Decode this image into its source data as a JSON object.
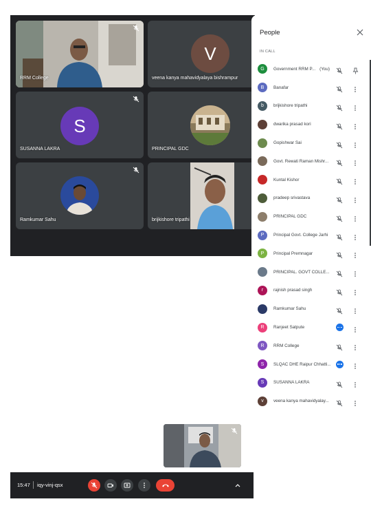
{
  "tiles": {
    "rrm": {
      "name": "RRM College"
    },
    "veena": {
      "name": "veena kanya mahavidyalaya bishrampur",
      "initial": "V"
    },
    "susanna": {
      "name": "SUSANNA LAKRA",
      "initial": "S"
    },
    "principal_gdc": {
      "name": "PRINCIPAL GDC"
    },
    "ramkumar": {
      "name": "Ramkumar Sahu"
    },
    "brijkishore": {
      "name": "brijkishore tripathi"
    }
  },
  "panel": {
    "title": "People",
    "section": "IN CALL",
    "participants": [
      {
        "name": "Government RRM P...",
        "you": "(You)",
        "initial": "G",
        "color": "#1e8e3e",
        "action": "pin"
      },
      {
        "name": "Banafar",
        "initial": "B",
        "color": "#5c6bc0",
        "action": "more"
      },
      {
        "name": "brijkishore tripathi",
        "initial": "b",
        "color": "#455a64",
        "action": "more"
      },
      {
        "name": "dwarika prasad kori",
        "initial": "",
        "color": "#5d4037",
        "action": "more"
      },
      {
        "name": "Gopishwar Sai",
        "initial": "",
        "color": "#6d8b4e",
        "action": "more"
      },
      {
        "name": "Govt. Rewati Raman Mishr...",
        "initial": "",
        "color": "#7a6a5a",
        "action": "more"
      },
      {
        "name": "Kuntal Kishor",
        "initial": "",
        "color": "#c62828",
        "action": "more"
      },
      {
        "name": "pradeep srivastava",
        "initial": "",
        "color": "#4e5d3a",
        "action": "more"
      },
      {
        "name": "PRINCIPAL GDC",
        "initial": "",
        "color": "#8d7e6b",
        "action": "more"
      },
      {
        "name": "Principal Govt. College Jarhi",
        "initial": "P",
        "color": "#5c6bc0",
        "action": "more"
      },
      {
        "name": "Principal Premnagar",
        "initial": "P",
        "color": "#7cb342",
        "action": "more"
      },
      {
        "name": "PRINCIPAL. GOVT COLLE...",
        "initial": "",
        "color": "#6b7a8a",
        "action": "more"
      },
      {
        "name": "rajnish prasad singh",
        "initial": "r",
        "color": "#ad1457",
        "action": "more"
      },
      {
        "name": "Ramkumar Sahu",
        "initial": "",
        "color": "#2b3a67",
        "action": "more"
      },
      {
        "name": "Ranjeet Satpute",
        "initial": "R",
        "color": "#ec407a",
        "action": "more",
        "speaking": true
      },
      {
        "name": "RRM College",
        "initial": "R",
        "color": "#7e57c2",
        "action": "more"
      },
      {
        "name": "SLQAC DHE Raipur Chhatti...",
        "initial": "S",
        "color": "#8e24aa",
        "action": "more",
        "speaking": true
      },
      {
        "name": "SUSANNA LAKRA",
        "initial": "S",
        "color": "#673ab7",
        "action": "more"
      },
      {
        "name": "veena kanya mahavidyalay...",
        "initial": "v",
        "color": "#5d4037",
        "action": "more"
      }
    ]
  },
  "controls": {
    "time": "15:47",
    "meeting_code": "iqy-vinj-qsx"
  },
  "colors": {
    "stage": "#202124",
    "tile": "#3c4043",
    "red": "#ea4335",
    "blue": "#1a73e8"
  }
}
